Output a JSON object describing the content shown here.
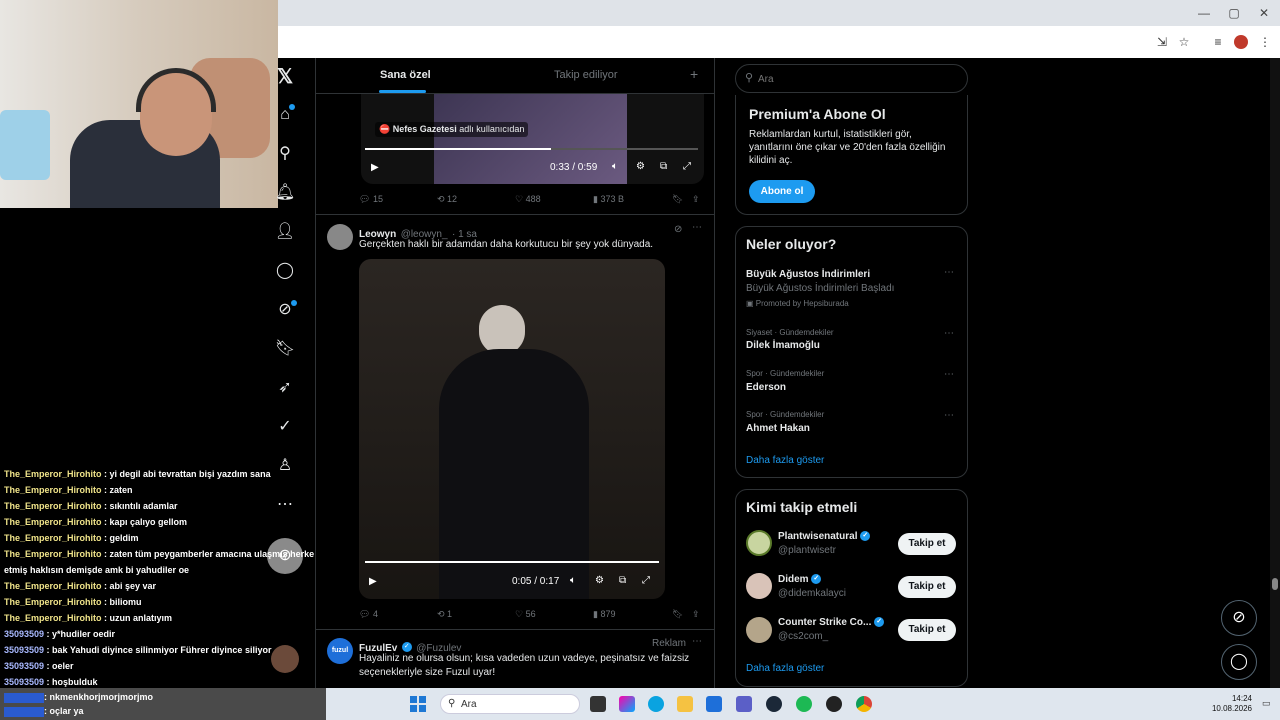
{
  "feed": {
    "tabs": [
      "Sana özel",
      "Takip ediliyor"
    ],
    "tweet1": {
      "overlay_source": "Nefes Gazetesi",
      "overlay_suffix": "adlı kullanıcıdan",
      "video_time": "0:33 / 0:59",
      "replies": "15",
      "reposts": "12",
      "likes": "488",
      "views": "373 B"
    },
    "tweet2": {
      "name": "Leowyn",
      "handle": "@leowyn_",
      "time": "· 1 sa",
      "text": "Gerçekten haklı bir adamdan daha korkutucu bir şey yok dünyada.",
      "video_time": "0:05 / 0:17",
      "replies": "4",
      "reposts": "1",
      "likes": "56",
      "views": "879"
    },
    "tweet3": {
      "name": "FuzulEv",
      "handle": "@Fuzulev",
      "ad_label": "Reklam",
      "avatar_text": "fuzul",
      "text_1": "Hayaliniz ne olursa olsun; kısa vadeden uzun vadeye, peşinatsız ve faizsiz",
      "text_2": "seçenekleriyle size Fuzul uyar!"
    }
  },
  "search": {
    "placeholder": "Ara"
  },
  "premium": {
    "title": "Premium'a Abone Ol",
    "desc_1": "Reklamlardan kurtul, istatistikleri gör,",
    "desc_2": "yanıtlarını öne çıkar ve 20'den fazla özelliğin",
    "desc_3": "kilidini aç.",
    "button": "Abone ol"
  },
  "trends": {
    "title": "Neler oluyor?",
    "promoted": {
      "name": "Büyük Ağustos İndirimleri",
      "sub": "Büyük Ağustos İndirimleri Başladı",
      "by": "Promoted by Hepsiburada"
    },
    "items": [
      {
        "category": "Siyaset · Gündemdekiler",
        "name": "Dilek İmamoğlu"
      },
      {
        "category": "Spor · Gündemdekiler",
        "name": "Ederson"
      },
      {
        "category": "Spor · Gündemdekiler",
        "name": "Ahmet Hakan"
      }
    ],
    "show_more": "Daha fazla göster"
  },
  "who_to_follow": {
    "title": "Kimi takip etmeli",
    "users": [
      {
        "name": "Plantwisenatural",
        "handle": "@plantwisetr"
      },
      {
        "name": "Didem",
        "handle": "@didemkalayci"
      },
      {
        "name": "Counter Strike Co...",
        "handle": "@cs2com_"
      }
    ],
    "follow_label": "Takip et",
    "show_more": "Daha fazla göster"
  },
  "chat": {
    "lines": [
      {
        "user": "The_Emperor_Hirohito",
        "msg": " : yi degil abi tevrattan bişi yazdım sana",
        "alt": false
      },
      {
        "user": "The_Emperor_Hirohito",
        "msg": " : zaten",
        "alt": false
      },
      {
        "user": "The_Emperor_Hirohito",
        "msg": " : sıkıntılı adamlar",
        "alt": false
      },
      {
        "user": "The_Emperor_Hirohito",
        "msg": " : kapı çalıyo gellom",
        "alt": false
      },
      {
        "user": "The_Emperor_Hirohito",
        "msg": " : geldim",
        "alt": false
      },
      {
        "user": "The_Emperor_Hirohito",
        "msg": " : zaten tüm peygamberler amacına ulaşmış herkes biat",
        "alt": false
      },
      {
        "user": "",
        "msg": "etmiş haklısın demişde amk bi yahudiler oe",
        "alt": false
      },
      {
        "user": "The_Emperor_Hirohito",
        "msg": " : abi şey var",
        "alt": false
      },
      {
        "user": "The_Emperor_Hirohito",
        "msg": " : biliomu",
        "alt": false
      },
      {
        "user": "The_Emperor_Hirohito",
        "msg": " : uzun anlatıyım",
        "alt": false
      },
      {
        "user": "35093509",
        "msg": " : y*hudiler oedir",
        "alt": true
      },
      {
        "user": "35093509",
        "msg": " : bak Yahudi diyince silinmiyor Führer diyince siliyor",
        "alt": true
      },
      {
        "user": "35093509",
        "msg": " : oeler",
        "alt": true
      },
      {
        "user": "35093509",
        "msg": " : hoşbulduk",
        "alt": true
      }
    ],
    "bottom_1": ": nkmenkhorjmorjmorjmo",
    "bottom_2": ": oçlar ya"
  },
  "taskbar": {
    "search": "Ara",
    "time": "14:24",
    "date": "10.08.2026"
  }
}
